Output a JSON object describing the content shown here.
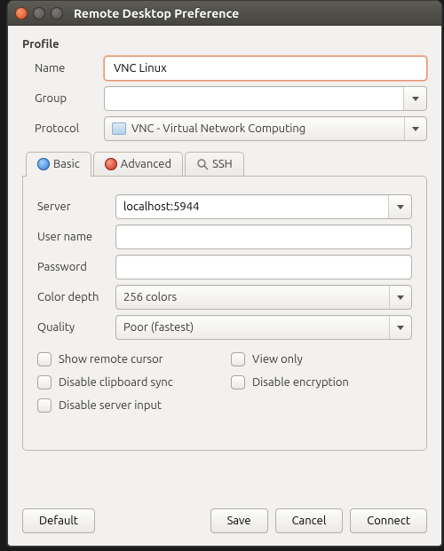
{
  "window": {
    "title": "Remote Desktop Preference"
  },
  "profile": {
    "section_label": "Profile",
    "name_label": "Name",
    "name_value": "VNC Linux",
    "group_label": "Group",
    "group_value": "",
    "protocol_label": "Protocol",
    "protocol_value": "VNC - Virtual Network Computing"
  },
  "tabs": {
    "basic": "Basic",
    "advanced": "Advanced",
    "ssh": "SSH"
  },
  "basic": {
    "server_label": "Server",
    "server_value": "localhost:5944",
    "user_label": "User name",
    "user_value": "",
    "pass_label": "Password",
    "pass_value": "",
    "colordepth_label": "Color depth",
    "colordepth_value": "256 colors",
    "quality_label": "Quality",
    "quality_value": "Poor (fastest)",
    "chk_show_cursor": "Show remote cursor",
    "chk_view_only": "View only",
    "chk_clipboard": "Disable clipboard sync",
    "chk_encryption": "Disable encryption",
    "chk_server_input": "Disable server input"
  },
  "buttons": {
    "default": "Default",
    "save": "Save",
    "cancel": "Cancel",
    "connect": "Connect"
  }
}
